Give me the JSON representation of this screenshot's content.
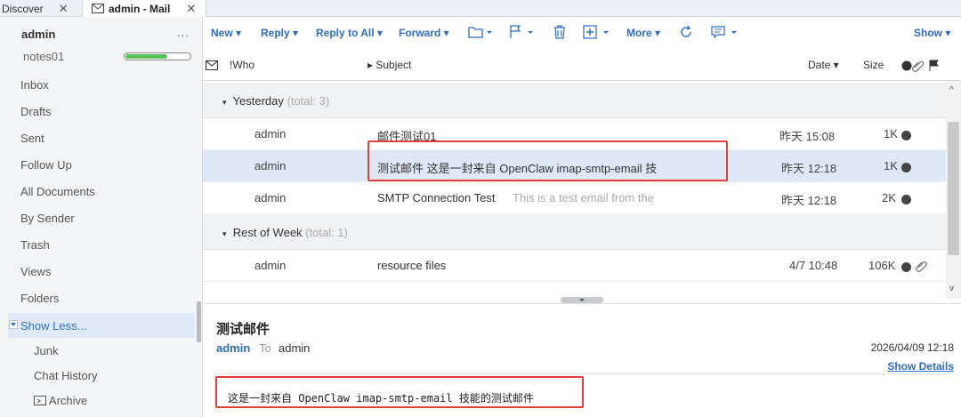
{
  "tabs": [
    {
      "label": "Discover",
      "close": "✕"
    },
    {
      "label": "admin - Mail",
      "close": "✕"
    }
  ],
  "sidebar": {
    "account": "admin",
    "more": "...",
    "quota_label": "notes01",
    "quota_fraction": 0.65,
    "items": [
      "Inbox",
      "Drafts",
      "Sent",
      "Follow Up",
      "All Documents",
      "By Sender",
      "Trash",
      "Views",
      "Folders"
    ],
    "show_less": "Show Less...",
    "subitems": [
      "Junk",
      "Chat History",
      "Archive"
    ]
  },
  "toolbar": {
    "new": "New ▾",
    "reply": "Reply ▾",
    "reply_all": "Reply to All ▾",
    "forward": "Forward ▾",
    "more": "More ▾",
    "show": "Show ▾"
  },
  "columns": {
    "who": "!Who",
    "subject": "▸ Subject",
    "date": "Date ▾",
    "size": "Size"
  },
  "groups": [
    {
      "label": "Yesterday",
      "count": "(total: 3)"
    },
    {
      "label": "Rest of Week",
      "count": "(total: 1)"
    }
  ],
  "messages": [
    {
      "who": "admin",
      "subject": "邮件测试01",
      "preview": "",
      "date": "昨天 15:08",
      "size": "1K",
      "selected": false,
      "attachment": false
    },
    {
      "who": "admin",
      "subject": "测试邮件  这是一封来自 OpenClaw imap-smtp-email 技",
      "preview": "",
      "date": "昨天 12:18",
      "size": "1K",
      "selected": true,
      "attachment": false
    },
    {
      "who": "admin",
      "subject": "SMTP Connection Test",
      "preview": "This is a test email from the",
      "date": "昨天 12:18",
      "size": "2K",
      "selected": false,
      "attachment": false
    },
    {
      "who": "admin",
      "subject": "resource files",
      "preview": "",
      "date": "4/7 10:48",
      "size": "106K",
      "selected": false,
      "attachment": true
    }
  ],
  "reading": {
    "subject": "测试邮件",
    "from": "admin",
    "to_label": "To",
    "to": "admin",
    "date": "2026/04/09 12:18",
    "details": "Show Details",
    "body": "这是一封来自 OpenClaw imap-smtp-email 技能的测试邮件"
  },
  "colors": {
    "accent": "#2d6cc7",
    "highlight": "#e0403a",
    "selected_row": "#dfe8f6",
    "quota_fill": "#58c45a"
  }
}
